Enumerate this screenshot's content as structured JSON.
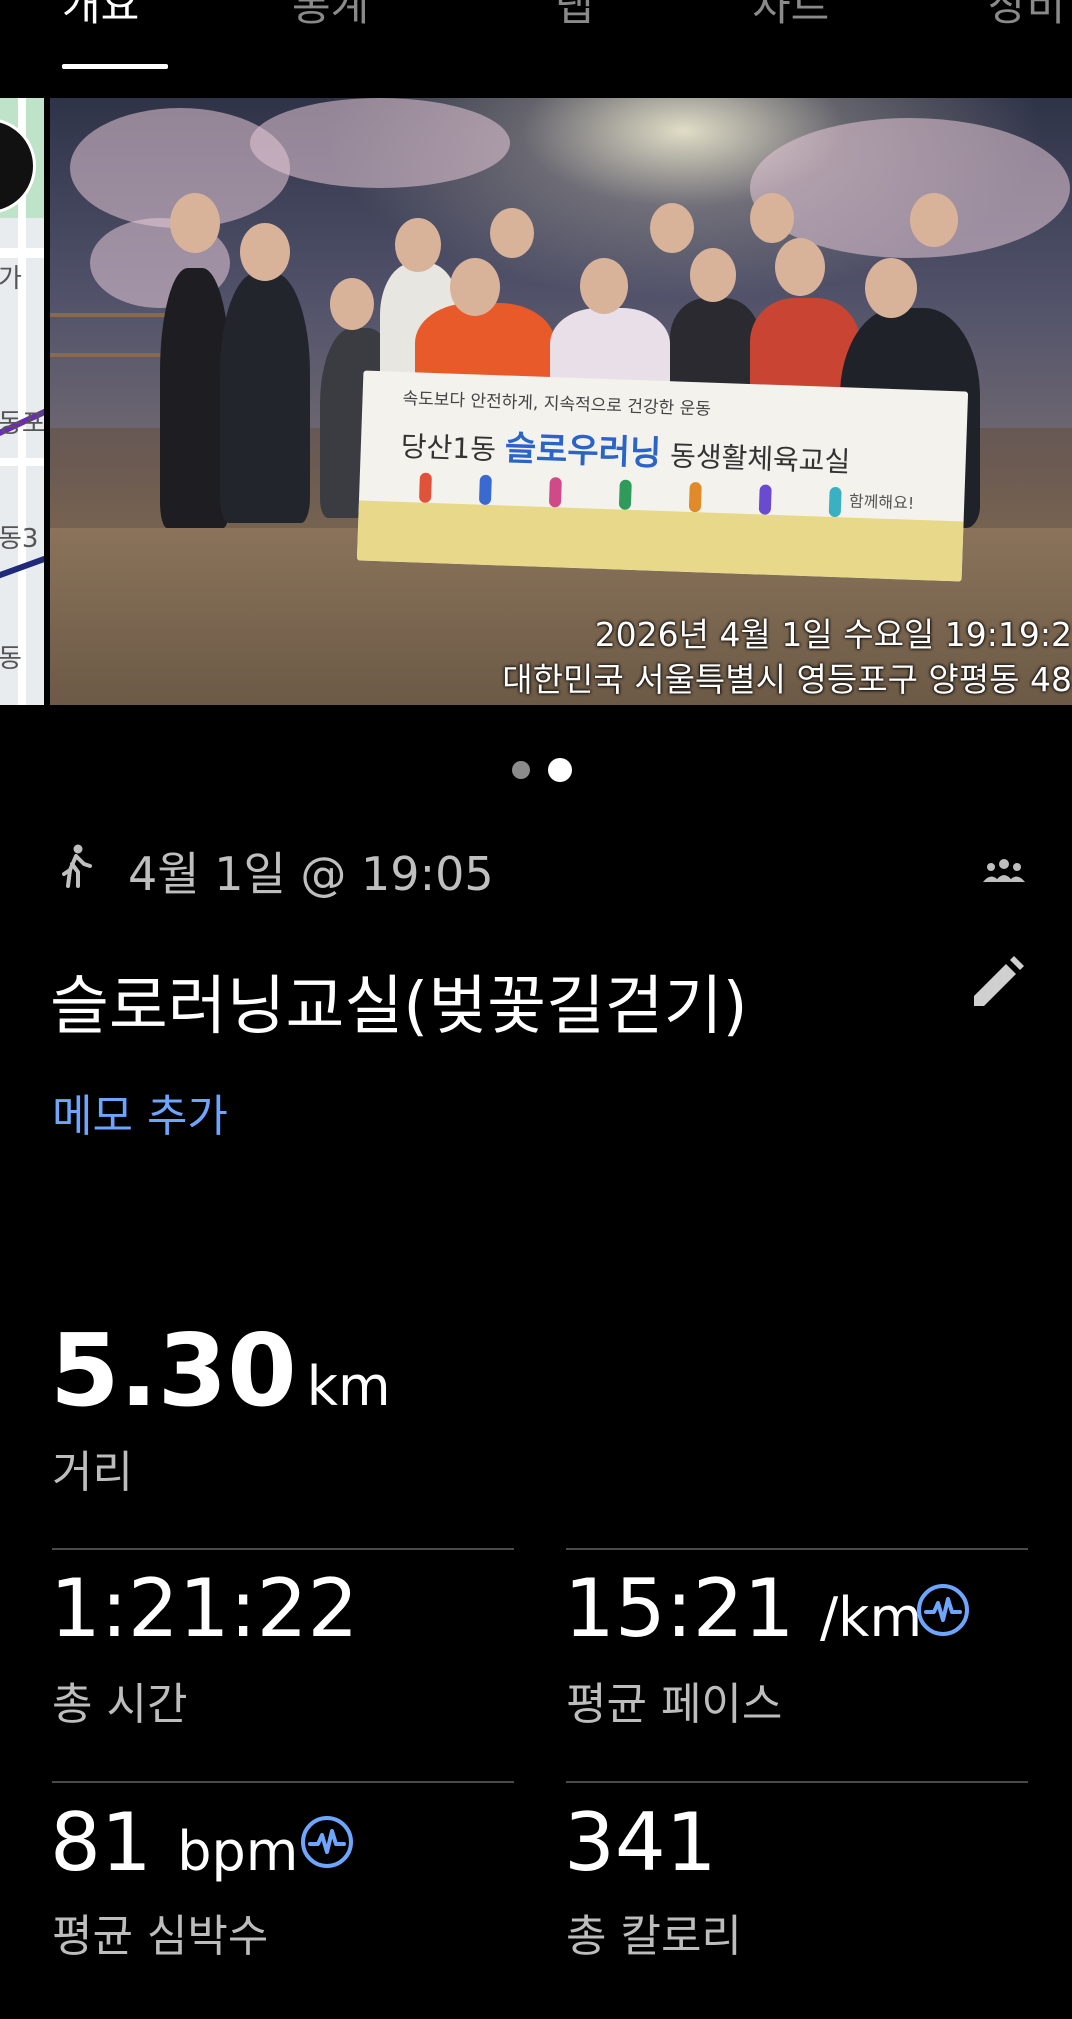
{
  "tabs": [
    {
      "label": "개요",
      "active": true
    },
    {
      "label": "통계",
      "active": false
    },
    {
      "label": "랩",
      "active": false
    },
    {
      "label": "차트",
      "active": false
    },
    {
      "label": "장비",
      "active": false
    }
  ],
  "gallery": {
    "map_labels": [
      "가",
      "동포",
      "동3",
      "동"
    ],
    "banner": {
      "tagline": "속도보다 안전하게, 지속적으로 건강한 운동",
      "org": "당산1동",
      "highlight": "슬로우러닝",
      "rest": "동생활체육교실",
      "sub": "함께해요!"
    },
    "stamp_datetime": "2026년 4월 1일 수요일 19:19:2",
    "stamp_location": "대한민국 서울특별시 영등포구 양평동 48",
    "page_count": 2,
    "current_page": 2
  },
  "activity": {
    "icon": "walk-icon",
    "date": "4월 1일 @ 19:05",
    "title": "슬로러닝교실(벚꽃길걷기)",
    "memo_link": "메모 추가"
  },
  "stats": {
    "distance": {
      "value": "5.30",
      "unit": "km",
      "label": "거리"
    },
    "total_time": {
      "value": "1:21:22",
      "label": "총 시간"
    },
    "avg_pace": {
      "value": "15:21",
      "unit": "/km",
      "label": "평균 페이스"
    },
    "avg_hr": {
      "value": "81",
      "unit": "bpm",
      "label": "평균 심박수"
    },
    "calories": {
      "value": "341",
      "label": "총 칼로리"
    }
  },
  "colors": {
    "background": "#000000",
    "accent": "#6ea5ff",
    "label": "#bdbdbd"
  }
}
